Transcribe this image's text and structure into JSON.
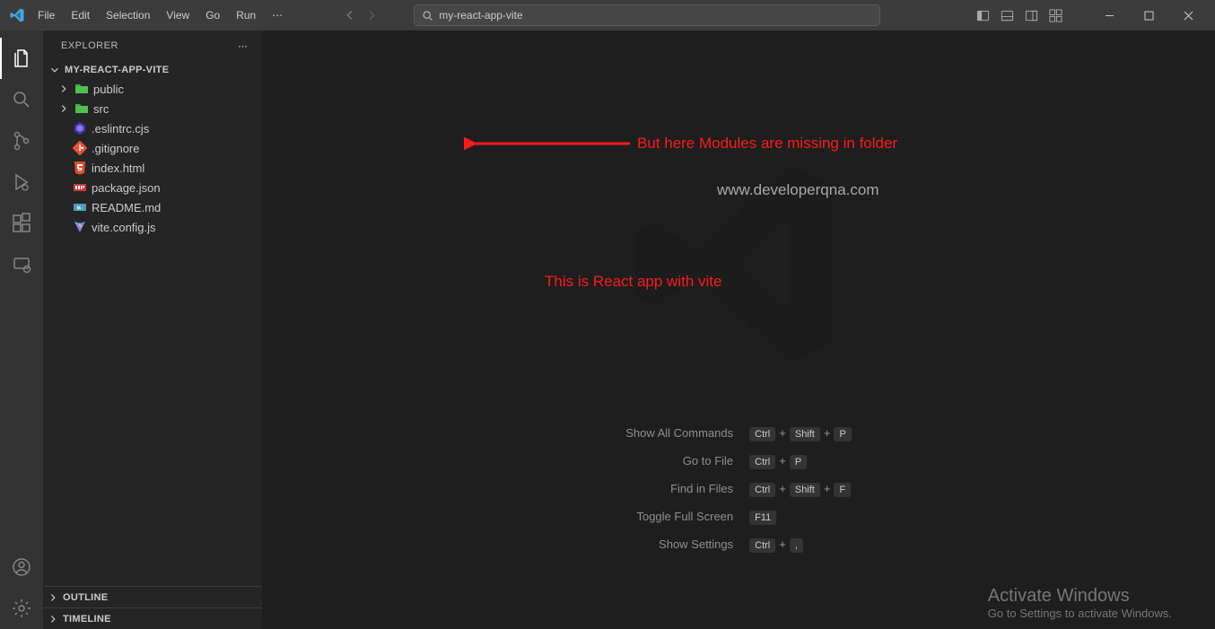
{
  "titlebar": {
    "menu": [
      "File",
      "Edit",
      "Selection",
      "View",
      "Go",
      "Run"
    ],
    "search_value": "my-react-app-vite"
  },
  "sidebar": {
    "title": "EXPLORER",
    "project": "MY-REACT-APP-VITE",
    "tree": [
      {
        "type": "folder",
        "name": "public"
      },
      {
        "type": "folder",
        "name": "src"
      },
      {
        "type": "file",
        "name": ".eslintrc.cjs",
        "icon": "eslint"
      },
      {
        "type": "file",
        "name": ".gitignore",
        "icon": "git"
      },
      {
        "type": "file",
        "name": "index.html",
        "icon": "html"
      },
      {
        "type": "file",
        "name": "package.json",
        "icon": "npm"
      },
      {
        "type": "file",
        "name": "README.md",
        "icon": "md"
      },
      {
        "type": "file",
        "name": "vite.config.js",
        "icon": "vite"
      }
    ],
    "sections": [
      "OUTLINE",
      "TIMELINE"
    ]
  },
  "welcome": {
    "shortcuts": [
      {
        "label": "Show All Commands",
        "keys": [
          "Ctrl",
          "Shift",
          "P"
        ]
      },
      {
        "label": "Go to File",
        "keys": [
          "Ctrl",
          "P"
        ]
      },
      {
        "label": "Find in Files",
        "keys": [
          "Ctrl",
          "Shift",
          "F"
        ]
      },
      {
        "label": "Toggle Full Screen",
        "keys": [
          "F11"
        ]
      },
      {
        "label": "Show Settings",
        "keys": [
          "Ctrl",
          ","
        ]
      }
    ]
  },
  "annotations": {
    "msg1": "But here Modules are missing in folder",
    "msg2": "This is React app with vite",
    "watermark": "www.developerqna.com"
  },
  "activate": {
    "title": "Activate Windows",
    "sub": "Go to Settings to activate Windows."
  }
}
